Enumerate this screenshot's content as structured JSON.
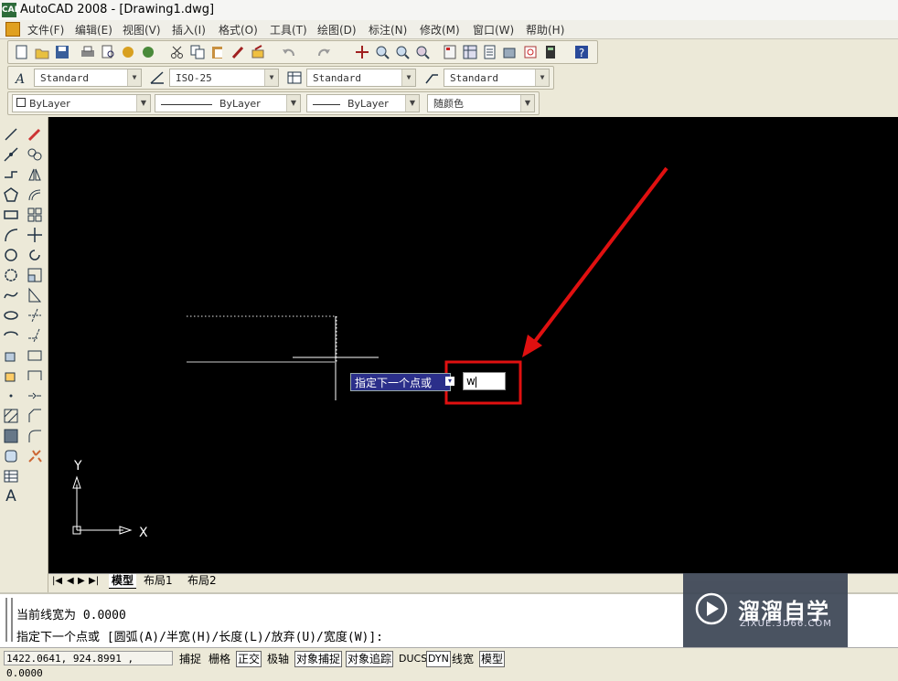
{
  "window": {
    "title": "AutoCAD 2008 - [Drawing1.dwg]",
    "logo_text": "CAD"
  },
  "menu": [
    "文件(F)",
    "编辑(E)",
    "视图(V)",
    "插入(I)",
    "格式(O)",
    "工具(T)",
    "绘图(D)",
    "标注(N)",
    "修改(M)",
    "窗口(W)",
    "帮助(H)"
  ],
  "styles_toolbar": {
    "text_style": "Standard",
    "dim_style": "ISO-25",
    "table_style": "Standard",
    "mleader_style": "Standard"
  },
  "properties_toolbar": {
    "layer": "ByLayer",
    "linetype": "ByLayer",
    "lineweight": "ByLayer",
    "color": "随颜色"
  },
  "tooltip": {
    "prompt": "指定下一个点或",
    "input_value": "w"
  },
  "ucs": {
    "y_label": "Y",
    "x_label": "X"
  },
  "tabs": [
    "模型",
    "布局1",
    "布局2"
  ],
  "command": {
    "history": "当前线宽为 0.0000",
    "prompt": "指定下一个点或 [圆弧(A)/半宽(H)/长度(L)/放弃(U)/宽度(W)]:"
  },
  "status": {
    "coords": "1422.0641, 924.8991 , 0.0000",
    "buttons": [
      "捕捉",
      "栅格",
      "正交",
      "极轴",
      "对象捕捉",
      "对象追踪",
      "DUCS",
      "DYN",
      "线宽",
      "模型"
    ]
  },
  "watermark": {
    "brand": "溜溜自学",
    "url": "ZIXUE.3D66.COM"
  },
  "colors": {
    "canvas": "#000000",
    "annotation": "#e01010",
    "tooltip_bg": "#2b2f8a"
  }
}
